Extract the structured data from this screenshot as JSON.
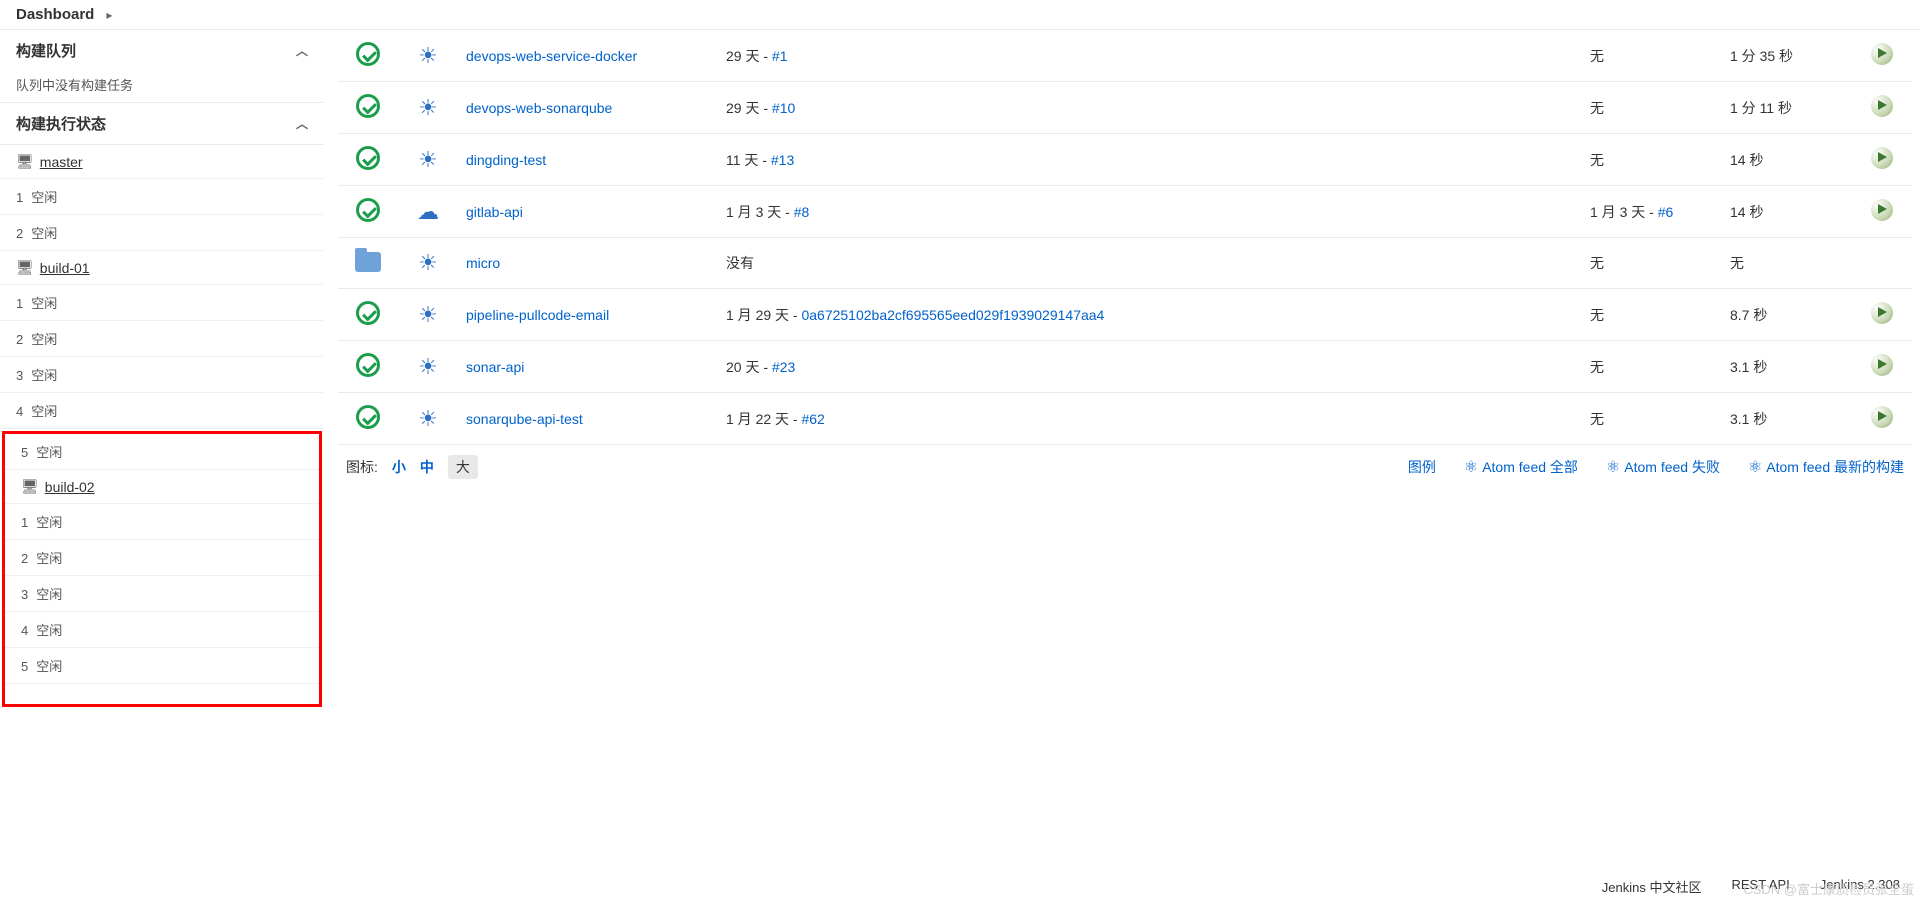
{
  "breadcrumb": {
    "title": "Dashboard",
    "arrow": "▸"
  },
  "sidebar": {
    "queue": {
      "title": "构建队列",
      "empty": "队列中没有构建任务"
    },
    "exec": {
      "title": "构建执行状态"
    },
    "nodes": [
      {
        "name": "master",
        "slots": [
          "空闲",
          "空闲"
        ]
      },
      {
        "name": "build-01",
        "slots": [
          "空闲",
          "空闲",
          "空闲",
          "空闲",
          "空闲"
        ]
      },
      {
        "name": "build-02",
        "slots": [
          "空闲",
          "空闲",
          "空闲",
          "空闲",
          "空闲"
        ],
        "highlight": true
      }
    ]
  },
  "jobs": [
    {
      "status": "ok",
      "weather": "sun",
      "name": "devops-web-service-docker",
      "last": "29 天 - ",
      "hash": "#1",
      "fail": "无",
      "dur": "1 分 35 秒",
      "run": true
    },
    {
      "status": "ok",
      "weather": "sun",
      "name": "devops-web-sonarqube",
      "last": "29 天 - ",
      "hash": "#10",
      "fail": "无",
      "dur": "1 分 11 秒",
      "run": true
    },
    {
      "status": "ok",
      "weather": "sun",
      "name": "dingding-test",
      "last": "11 天 - ",
      "hash": "#13",
      "fail": "无",
      "dur": "14 秒",
      "run": true
    },
    {
      "status": "ok",
      "weather": "cloud",
      "name": "gitlab-api",
      "last": "1 月 3 天 - ",
      "hash": "#8",
      "fail": "1 月 3 天 - ",
      "failhash": "#6",
      "dur": "14 秒",
      "run": true
    },
    {
      "status": "folder",
      "weather": "sun",
      "name": "micro",
      "last": "没有",
      "hash": "",
      "fail": "无",
      "dur": "无",
      "run": false
    },
    {
      "status": "ok",
      "weather": "sun",
      "name": "pipeline-pullcode-email",
      "last": "1 月 29 天 - ",
      "hash": "0a6725102ba2cf695565eed029f1939029147aa4",
      "fail": "无",
      "dur": "8.7 秒",
      "run": true
    },
    {
      "status": "ok",
      "weather": "sun",
      "name": "sonar-api",
      "last": "20 天 - ",
      "hash": "#23",
      "fail": "无",
      "dur": "3.1 秒",
      "run": true
    },
    {
      "status": "ok",
      "weather": "sun",
      "name": "sonarqube-api-test",
      "last": "1 月 22 天 - ",
      "hash": "#62",
      "fail": "无",
      "dur": "3.1 秒",
      "run": true
    }
  ],
  "iconsize": {
    "label": "图标:",
    "small": "小",
    "medium": "中",
    "large": "大"
  },
  "links": {
    "legend": "图例",
    "feed_all": "Atom feed 全部",
    "feed_fail": "Atom feed 失败",
    "feed_latest": "Atom feed 最新的构建"
  },
  "footer": {
    "community": "Jenkins 中文社区",
    "rest": "REST API",
    "version": "Jenkins 2.308"
  },
  "watermark": "CSDN @富士康质检员张全蛋"
}
